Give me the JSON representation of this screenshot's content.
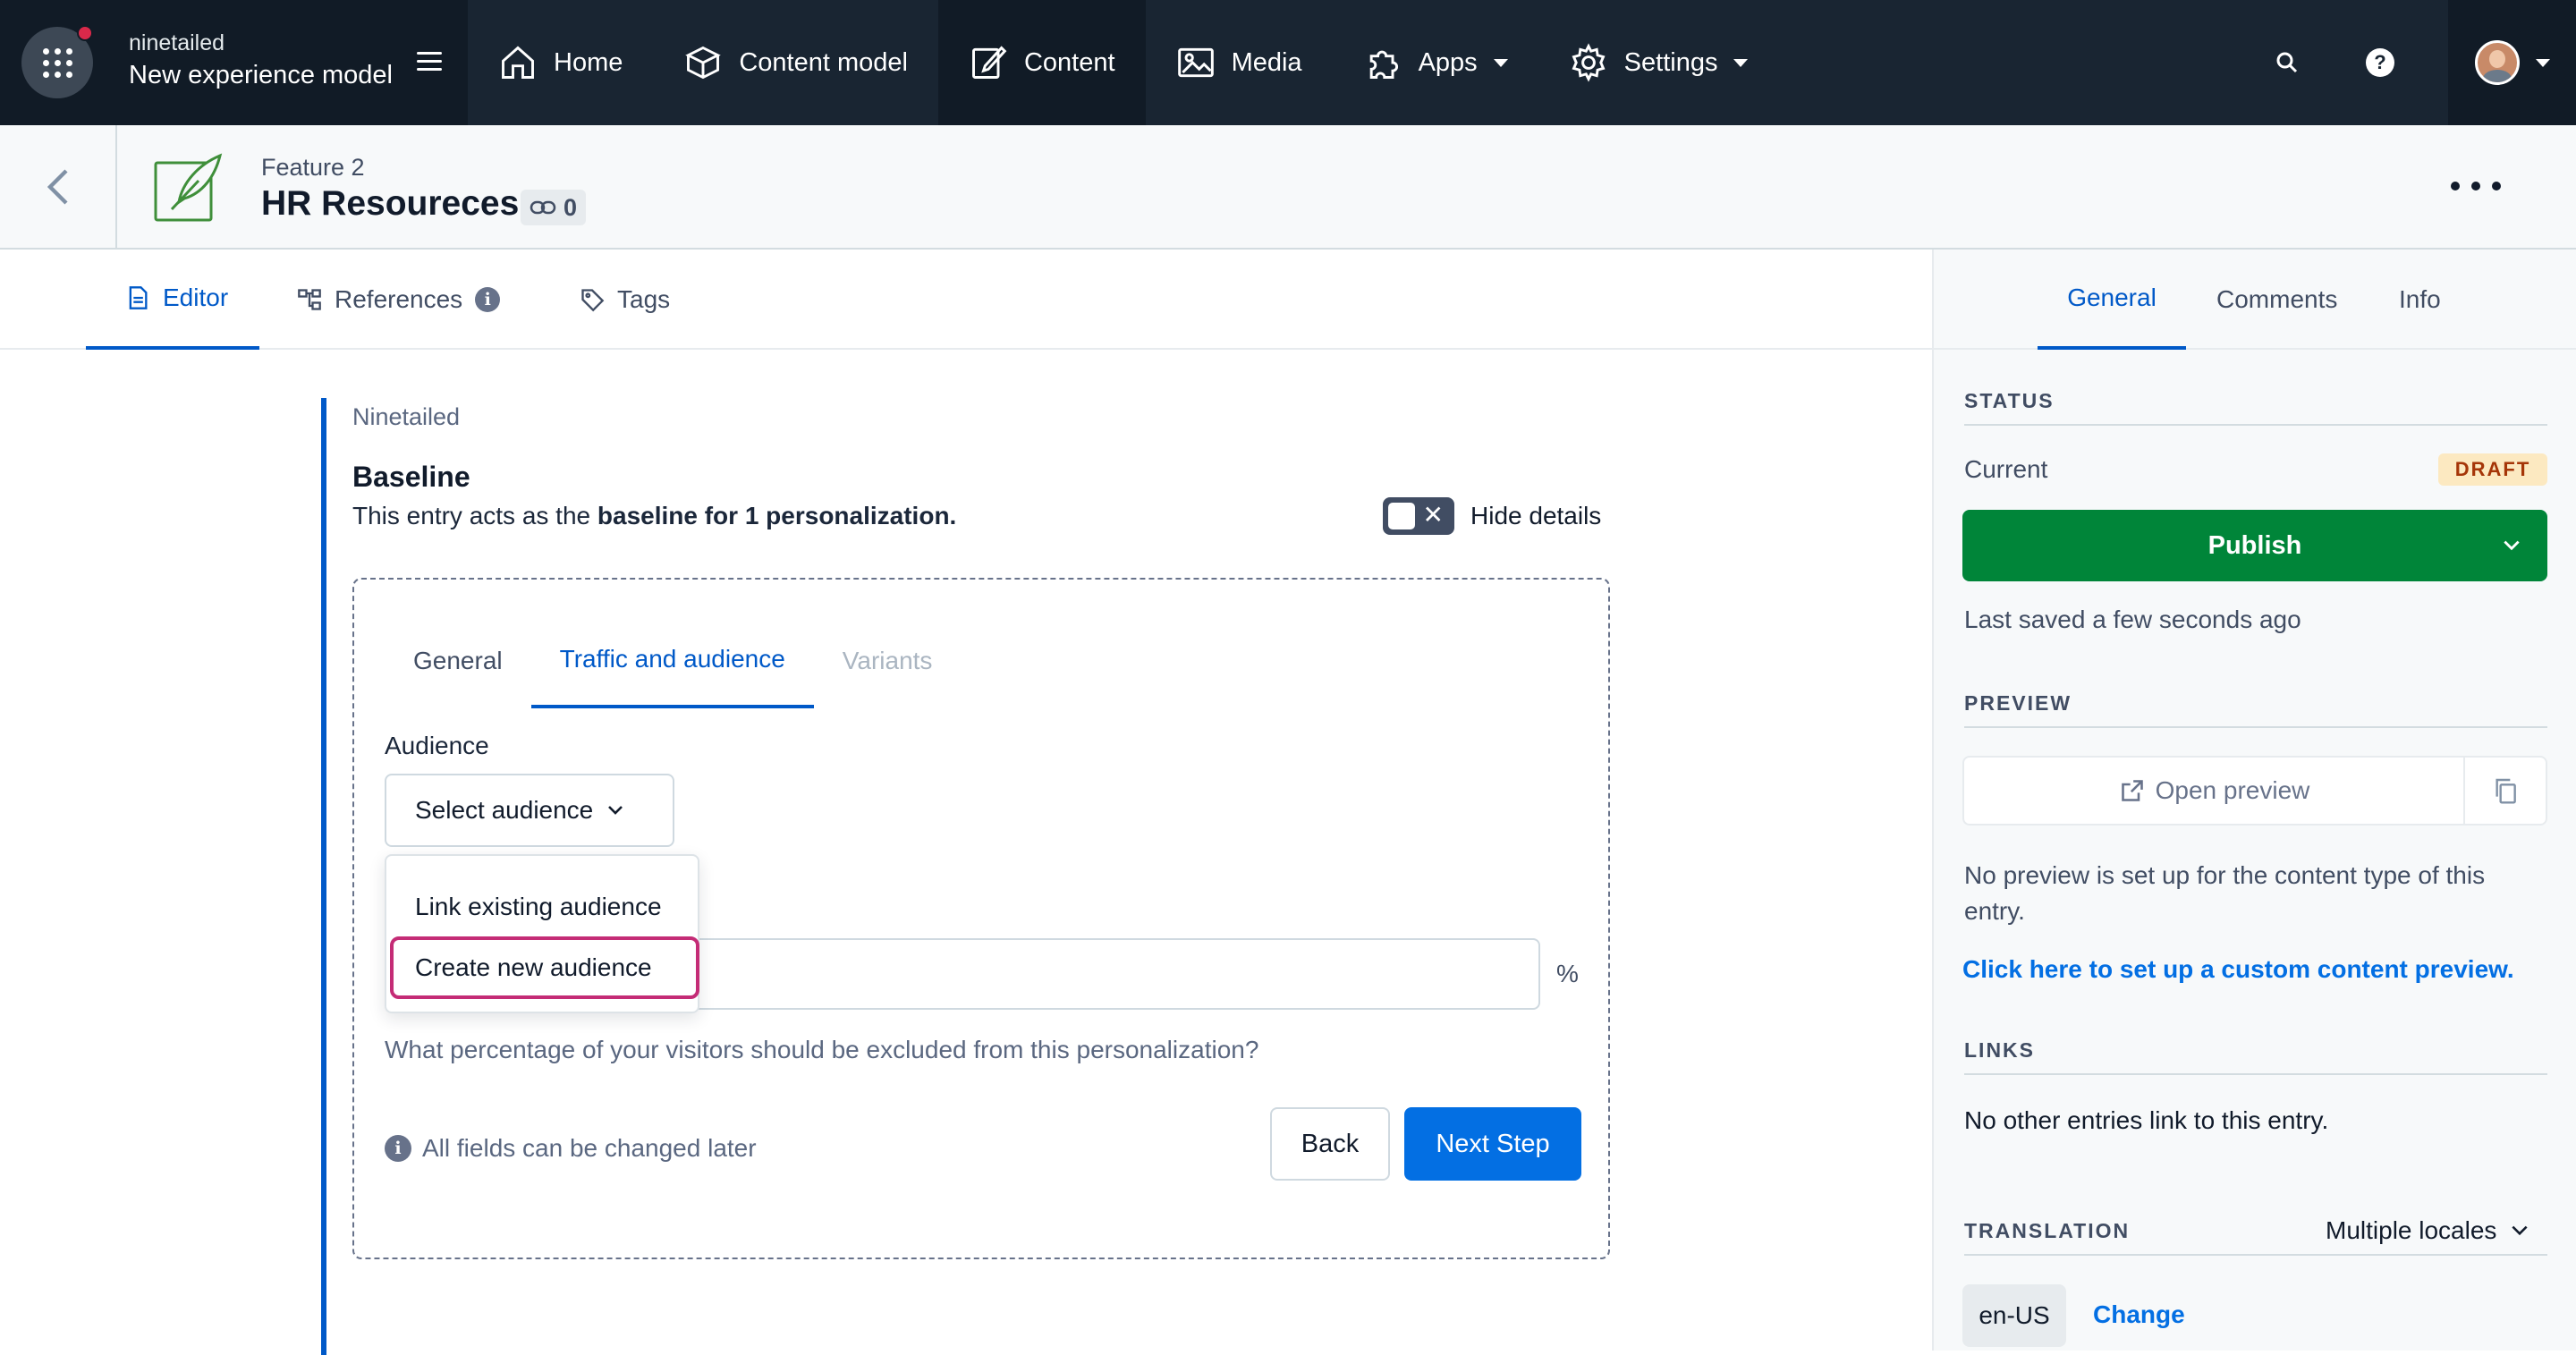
{
  "topbar": {
    "org_name": "ninetailed",
    "space_name": "New experience model",
    "nav": [
      {
        "label": "Home",
        "icon": "home-icon"
      },
      {
        "label": "Content model",
        "icon": "content-model-icon"
      },
      {
        "label": "Content",
        "icon": "content-icon"
      },
      {
        "label": "Media",
        "icon": "media-icon"
      },
      {
        "label": "Apps",
        "icon": "apps-icon"
      },
      {
        "label": "Settings",
        "icon": "settings-icon"
      }
    ],
    "help_glyph": "?"
  },
  "entry": {
    "content_type": "Feature 2",
    "title": "HR Resoureces",
    "reference_count": "0"
  },
  "editor_tabs": {
    "editor": "Editor",
    "references": "References",
    "tags": "Tags",
    "info_glyph": "i"
  },
  "main": {
    "field_label": "Ninetailed",
    "baseline_title": "Baseline",
    "baseline_desc_prefix": "This entry acts as the",
    "baseline_desc_bold": "baseline for 1 personalization.",
    "toggle_label": "Hide details",
    "inner_tabs": [
      "General",
      "Traffic and audience",
      "Variants"
    ],
    "audience_label": "Audience",
    "select_audience": "Select audience",
    "dropdown_items": [
      "Link existing audience",
      "Create new audience"
    ],
    "percent_sign": "%",
    "percent_help": "What percentage of your visitors should be excluded from this personalization?",
    "fields_note": "All fields can be changed later",
    "back_label": "Back",
    "next_label": "Next Step"
  },
  "sidebar": {
    "tabs": [
      "General",
      "Comments",
      "Info"
    ],
    "status_heading": "STATUS",
    "current_label": "Current",
    "status_badge": "DRAFT",
    "publish_label": "Publish",
    "last_saved": "Last saved a few seconds ago",
    "preview_heading": "PREVIEW",
    "open_preview": "Open preview",
    "no_preview_line1": "No preview is set up for the content type of this",
    "no_preview_line2": "entry.",
    "setup_preview_link": "Click here to set up a custom content preview.",
    "links_heading": "LINKS",
    "links_text": "No other entries link to this entry.",
    "translation_heading": "TRANSLATION",
    "locales_select": "Multiple locales",
    "locale": "en-US",
    "change_link": "Change"
  },
  "colors": {
    "nav_bg": "#192532",
    "accent_blue": "#0059c8",
    "publish_green": "#008539",
    "draft_bg": "#fce9c1",
    "highlight_pink": "#c42c76"
  }
}
